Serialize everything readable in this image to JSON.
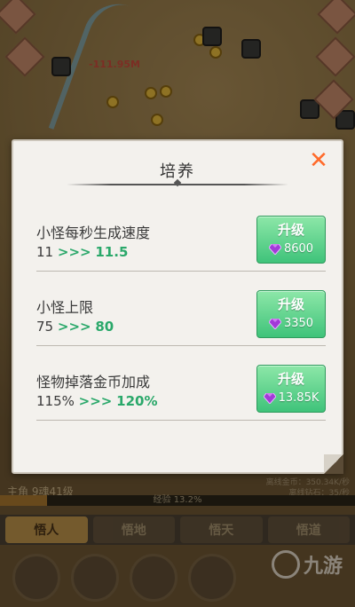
{
  "background": {
    "damage_text": "-111.95M",
    "master_label": "主角 9魂41级",
    "stats_line1": "离线金币：350.34K/秒",
    "stats_line2": "离线钻石：35/秒",
    "exp_text": "经验 13.2%",
    "exp_progress": 0.132,
    "tabs": [
      {
        "label": "悟人",
        "active": true
      },
      {
        "label": "悟地",
        "active": false
      },
      {
        "label": "悟天",
        "active": false
      },
      {
        "label": "悟道",
        "active": false
      }
    ],
    "watermark_text": "九游"
  },
  "dialog": {
    "title": "培养",
    "close_symbol": "✕",
    "rows": [
      {
        "name": "小怪每秒生成速度",
        "current": "11",
        "arrow": ">>>",
        "next": "11.5",
        "button_label": "升级",
        "cost": "8600"
      },
      {
        "name": "小怪上限",
        "current": "75",
        "arrow": ">>>",
        "next": "80",
        "button_label": "升级",
        "cost": "3350"
      },
      {
        "name": "怪物掉落金币加成",
        "current": "115%",
        "arrow": ">>>",
        "next": "120%",
        "button_label": "升级",
        "cost": "13.85K"
      }
    ]
  },
  "colors": {
    "accent_green": "#2aa86a",
    "button_green": "#3fc37a",
    "close_orange": "#ff6a2a",
    "gem_purple": "#a23ad8"
  },
  "icons": {
    "gem": "gem-icon",
    "close": "close-icon"
  }
}
